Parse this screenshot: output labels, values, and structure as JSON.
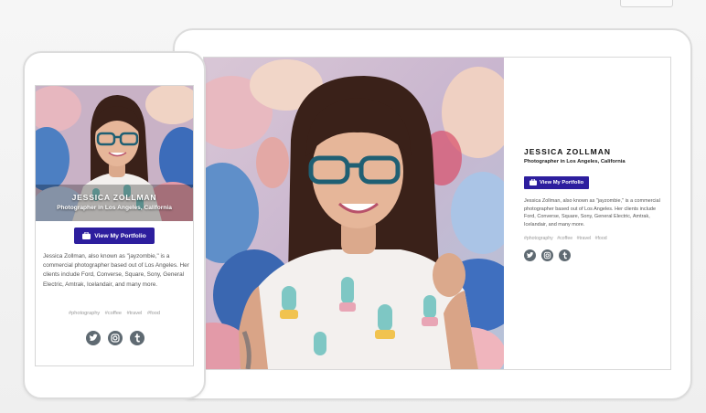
{
  "profile": {
    "name": "JESSICA ZOLLMAN",
    "subtitle": "Photographer in Los Angeles, California",
    "button_label": "View My Portfolio",
    "bio": "Jessica Zollman, also known as \"jayzombie,\" is a commercial photographer based out of Los Angeles. Her clients include Ford, Converse, Square, Sony, General Electric, Amtrak, Icelandair, and many more.",
    "tags": [
      "#photography",
      "#coffee",
      "#travel",
      "#food"
    ],
    "social_icons": [
      "twitter-icon",
      "instagram-icon",
      "tumblr-icon"
    ]
  },
  "colors": {
    "button": "#2d1e9e",
    "icon_circle": "#5f6a72",
    "device_border": "#dcdcdc"
  }
}
